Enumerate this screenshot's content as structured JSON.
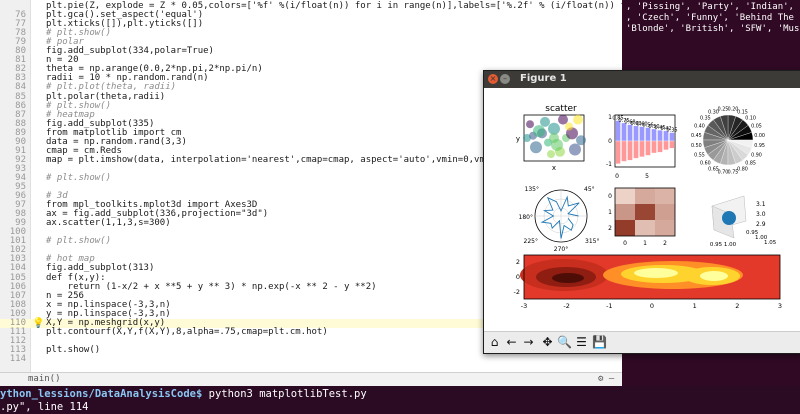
{
  "editor": {
    "lines": [
      {
        "n": "",
        "text": "plt.pie(Z, explode = Z * 0.05,colors=['%f' %(i/float(n)) for i in range(n)],labels=['%.2f' % (i/float(n)) for i in range(n)])",
        "kind": "code"
      },
      {
        "n": "76",
        "text": "plt.gca().set_aspect('equal')",
        "kind": "code"
      },
      {
        "n": "77",
        "text": "plt.xticks([]),plt.yticks([])",
        "kind": "code"
      },
      {
        "n": "78",
        "text": "# plt.show()",
        "kind": "comment"
      },
      {
        "n": "79",
        "text": "# polar",
        "kind": "comment"
      },
      {
        "n": "80",
        "text": "fig.add_subplot(334,polar=True)",
        "kind": "code"
      },
      {
        "n": "81",
        "text": "n = 20",
        "kind": "code"
      },
      {
        "n": "82",
        "text": "theta = np.arange(0.0,2*np.pi,2*np.pi/n)",
        "kind": "code"
      },
      {
        "n": "83",
        "text": "radii = 10 * np.random.rand(n)",
        "kind": "code"
      },
      {
        "n": "84",
        "text": "# plt.plot(theta, radii)",
        "kind": "comment"
      },
      {
        "n": "85",
        "text": "plt.polar(theta,radii)",
        "kind": "code"
      },
      {
        "n": "86",
        "text": "# plt.show()",
        "kind": "comment"
      },
      {
        "n": "87",
        "text": "# heatmap",
        "kind": "comment"
      },
      {
        "n": "88",
        "text": "fig.add_subplot(335)",
        "kind": "code"
      },
      {
        "n": "89",
        "text": "from matplotlib import cm",
        "kind": "code"
      },
      {
        "n": "90",
        "text": "data = np.random.rand(3,3)",
        "kind": "code"
      },
      {
        "n": "91",
        "text": "cmap = cm.Reds",
        "kind": "code"
      },
      {
        "n": "92",
        "text": "map = plt.imshow(data, interpolation='nearest',cmap=cmap, aspect='auto',vmin=0,vmax=1)",
        "kind": "code"
      },
      {
        "n": "93",
        "text": "",
        "kind": "code"
      },
      {
        "n": "94",
        "text": "# plt.show()",
        "kind": "comment"
      },
      {
        "n": "95",
        "text": "",
        "kind": "code"
      },
      {
        "n": "96",
        "text": "# 3d",
        "kind": "comment"
      },
      {
        "n": "97",
        "text": "from mpl_toolkits.mplot3d import Axes3D",
        "kind": "code"
      },
      {
        "n": "98",
        "text": "ax = fig.add_subplot(336,projection=\"3d\")",
        "kind": "code"
      },
      {
        "n": "99",
        "text": "ax.scatter(1,1,3,s=300)",
        "kind": "code"
      },
      {
        "n": "100",
        "text": "",
        "kind": "code"
      },
      {
        "n": "101",
        "text": "# plt.show()",
        "kind": "comment"
      },
      {
        "n": "102",
        "text": "",
        "kind": "code"
      },
      {
        "n": "103",
        "text": "# hot map",
        "kind": "comment"
      },
      {
        "n": "104",
        "text": "fig.add_subplot(313)",
        "kind": "code"
      },
      {
        "n": "105",
        "text": "def f(x,y):",
        "kind": "code"
      },
      {
        "n": "106",
        "text": "    return (1-x/2 + x **5 + y ** 3) * np.exp(-x ** 2 - y **2)",
        "kind": "code"
      },
      {
        "n": "107",
        "text": "n = 256",
        "kind": "code"
      },
      {
        "n": "108",
        "text": "x = np.linspace(-3,3,n)",
        "kind": "code"
      },
      {
        "n": "109",
        "text": "y = np.linspace(-3,3,n)",
        "kind": "code"
      },
      {
        "n": "110",
        "text": "X,Y = np.meshgrid(x,y)",
        "kind": "highlight"
      },
      {
        "n": "111",
        "text": "plt.contourf(X,Y,f(X,Y),8,alpha=.75,cmap=plt.cm.hot)",
        "kind": "code"
      },
      {
        "n": "112",
        "text": "",
        "kind": "code"
      },
      {
        "n": "113",
        "text": "plt.show()",
        "kind": "code"
      },
      {
        "n": "114",
        "text": "",
        "kind": "code"
      }
    ],
    "status_text": "main()"
  },
  "terminal": {
    "prompt_path": "ython_lessions/DataAnalysisCode$",
    "command": " python3 matplotlibTest.py",
    "line2": ".py\", line 114"
  },
  "right_terminal": {
    "line1": ", 'Pissing', 'Party', 'Indian', 'Pussy",
    "line2": ", 'Czech', 'Funny', 'Behind The Scene",
    "line3": "'Blonde', 'British', 'SFW', 'Music', 'E"
  },
  "figure": {
    "title": "Figure 1",
    "scatter_title": "scatter",
    "scatter_ylabel": "y",
    "scatter_xlabel": "x",
    "toolbar_icons": [
      "home-icon",
      "back-icon",
      "forward-icon",
      "pan-icon",
      "zoom-icon",
      "configure-icon",
      "save-icon"
    ]
  },
  "chart_data": [
    {
      "type": "scatter",
      "title": "scatter",
      "xlabel": "x",
      "ylabel": "y",
      "series": [
        {
          "name": "",
          "x": [
            0.1,
            0.3,
            0.5,
            0.7,
            0.9,
            0.2,
            0.4,
            0.6,
            0.8,
            0.15,
            0.35,
            0.55,
            0.75,
            0.95,
            0.25,
            0.45,
            0.65,
            0.85,
            0.05,
            0.5
          ],
          "y": [
            0.8,
            0.6,
            0.7,
            0.5,
            0.9,
            0.3,
            0.4,
            0.2,
            0.6,
            0.55,
            0.85,
            0.35,
            0.75,
            0.45,
            0.65,
            0.15,
            0.9,
            0.25,
            0.5,
            0.5
          ]
        }
      ]
    },
    {
      "type": "bar",
      "title": "",
      "categories": [
        "0",
        "1",
        "2",
        "3",
        "4",
        "5",
        "6",
        "7",
        "8",
        "9"
      ],
      "series": [
        {
          "name": "",
          "values": [
            0.85,
            0.75,
            0.68,
            0.63,
            0.6,
            0.56,
            0.5,
            0.45,
            0.42,
            0.35
          ]
        },
        {
          "name": "",
          "values": [
            -0.95,
            -0.85,
            -0.8,
            -0.72,
            -0.66,
            -0.6,
            -0.5,
            -0.47,
            -0.37,
            -0.3
          ]
        }
      ],
      "tick_labels_x": [
        "0",
        "5"
      ],
      "tick_labels_y": [
        "1",
        "0",
        "-1"
      ]
    },
    {
      "type": "pie",
      "title": "",
      "labels": [
        "0.00",
        "0.05",
        "0.10",
        "0.15",
        "0.20",
        "0.25",
        "0.30",
        "0.35",
        "0.40",
        "0.45",
        "0.50",
        "0.55",
        "0.60",
        "0.65",
        "0.70",
        "0.75",
        "0.80",
        "0.85",
        "0.90",
        "0.95"
      ]
    },
    {
      "type": "line",
      "title": "",
      "angle_ticks": [
        "45°",
        "135°",
        "180°",
        "225°",
        "270°",
        "315°"
      ]
    },
    {
      "type": "heatmap",
      "title": "",
      "x_ticks": [
        "0",
        "1",
        "2"
      ],
      "y_ticks": [
        "0",
        "1",
        "2"
      ],
      "values": [
        [
          0.15,
          0.35,
          0.3
        ],
        [
          0.45,
          0.85,
          0.4
        ],
        [
          0.9,
          0.25,
          0.35
        ]
      ]
    },
    {
      "type": "scatter",
      "title": "",
      "x_ticks": [
        "0.95",
        "1.00"
      ],
      "y_ticks": [
        "0.95",
        "1.00",
        "1.05"
      ],
      "z_ticks": [
        "2.9",
        "3.0",
        "3.1"
      ],
      "series": [
        {
          "name": "",
          "x": [
            1
          ],
          "y": [
            1
          ],
          "z": [
            3
          ]
        }
      ]
    },
    {
      "type": "heatmap",
      "title": "",
      "x_ticks": [
        "-3",
        "-2",
        "-1",
        "0",
        "1",
        "2",
        "3"
      ],
      "y_ticks": [
        "-2",
        "0",
        "2"
      ],
      "xlim": [
        -3,
        3
      ],
      "ylim": [
        -3,
        3
      ]
    }
  ]
}
